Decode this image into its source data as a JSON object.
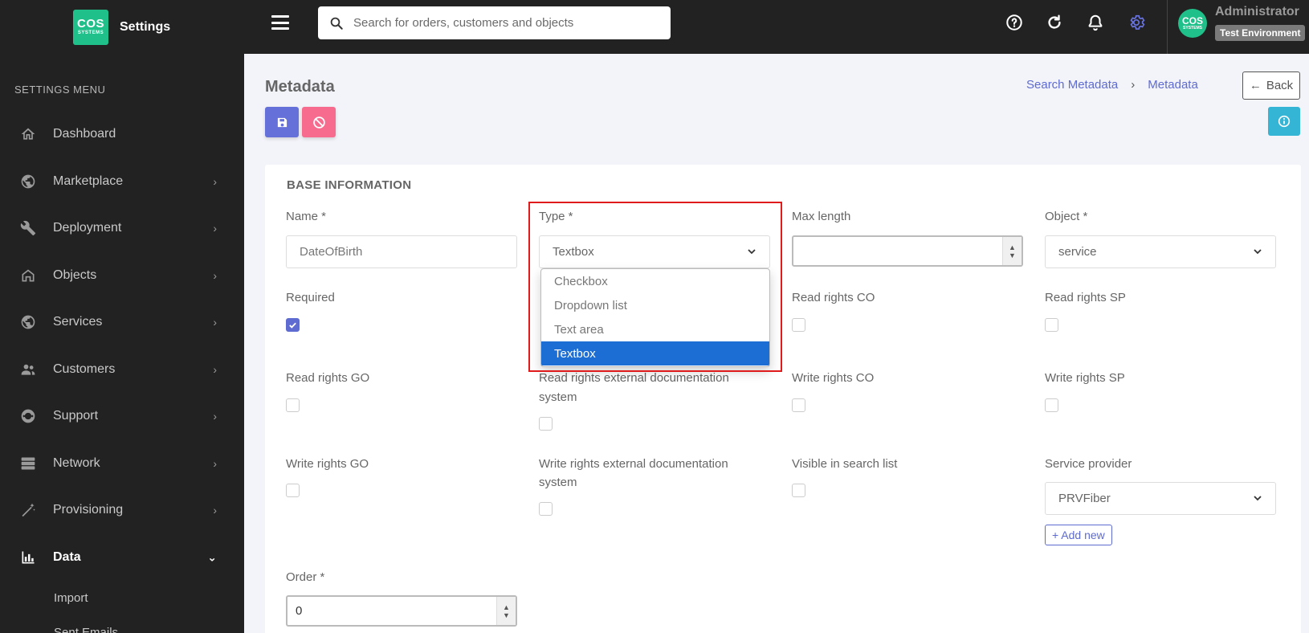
{
  "brand": {
    "logo_line1": "COS",
    "logo_line2": "SYSTEMS",
    "title": "Settings"
  },
  "sidebar": {
    "heading": "SETTINGS MENU",
    "items": [
      {
        "label": "Dashboard",
        "icon": "home-icon",
        "has_chevron": false
      },
      {
        "label": "Marketplace",
        "icon": "globe-icon",
        "has_chevron": true
      },
      {
        "label": "Deployment",
        "icon": "tools-icon",
        "has_chevron": true
      },
      {
        "label": "Objects",
        "icon": "house-icon",
        "has_chevron": true
      },
      {
        "label": "Services",
        "icon": "globe-icon",
        "has_chevron": true
      },
      {
        "label": "Customers",
        "icon": "users-icon",
        "has_chevron": true
      },
      {
        "label": "Support",
        "icon": "lifebuoy-icon",
        "has_chevron": true
      },
      {
        "label": "Network",
        "icon": "server-icon",
        "has_chevron": true
      },
      {
        "label": "Provisioning",
        "icon": "wand-icon",
        "has_chevron": true
      },
      {
        "label": "Data",
        "icon": "bar-chart-icon",
        "has_chevron": true,
        "expanded": true
      }
    ],
    "subitems": [
      "Import",
      "Sent Emails"
    ]
  },
  "topbar": {
    "search_placeholder": "Search for orders, customers and objects",
    "user_name": "Administrator",
    "env_badge": "Test Environment",
    "avatar_line1": "COS",
    "avatar_line2": "SYSTEMS"
  },
  "page": {
    "title": "Metadata",
    "breadcrumb": [
      "Search Metadata",
      "Metadata"
    ],
    "back_label": "Back"
  },
  "form": {
    "section_title": "BASE INFORMATION",
    "name": {
      "label": "Name *",
      "value": "DateOfBirth"
    },
    "type": {
      "label": "Type *",
      "value": "Textbox",
      "options": [
        "Checkbox",
        "Dropdown list",
        "Text area",
        "Textbox"
      ],
      "selected_index": 3
    },
    "max_length": {
      "label": "Max length",
      "value": ""
    },
    "object": {
      "label": "Object *",
      "value": "service"
    },
    "required": {
      "label": "Required",
      "checked": true
    },
    "read_rights_co": {
      "label": "Read rights CO",
      "checked": false
    },
    "read_rights_sp": {
      "label": "Read rights SP",
      "checked": false
    },
    "read_rights_go": {
      "label": "Read rights GO",
      "checked": false
    },
    "read_rights_ext": {
      "label_line1": "Read rights external documentation",
      "label_line2": "system",
      "checked": false
    },
    "write_rights_co": {
      "label": "Write rights CO",
      "checked": false
    },
    "write_rights_sp": {
      "label": "Write rights SP",
      "checked": false
    },
    "write_rights_go": {
      "label": "Write rights GO",
      "checked": false
    },
    "write_rights_ext": {
      "label_line1": "Write rights external documentation",
      "label_line2": "system",
      "checked": false
    },
    "visible_in_search": {
      "label": "Visible in search list",
      "checked": false
    },
    "service_provider": {
      "label": "Service provider",
      "value": "PRVFiber",
      "add_new_label": "+ Add new"
    },
    "order": {
      "label": "Order *",
      "value": "0"
    }
  },
  "colors": {
    "sidebar_bg": "#222222",
    "accent": "#5e6bd0",
    "danger": "#f76b8e",
    "info": "#34b5d5",
    "brand_green": "#20c08a",
    "selected_option": "#1c6ed4",
    "highlight": "#e01b1b"
  }
}
